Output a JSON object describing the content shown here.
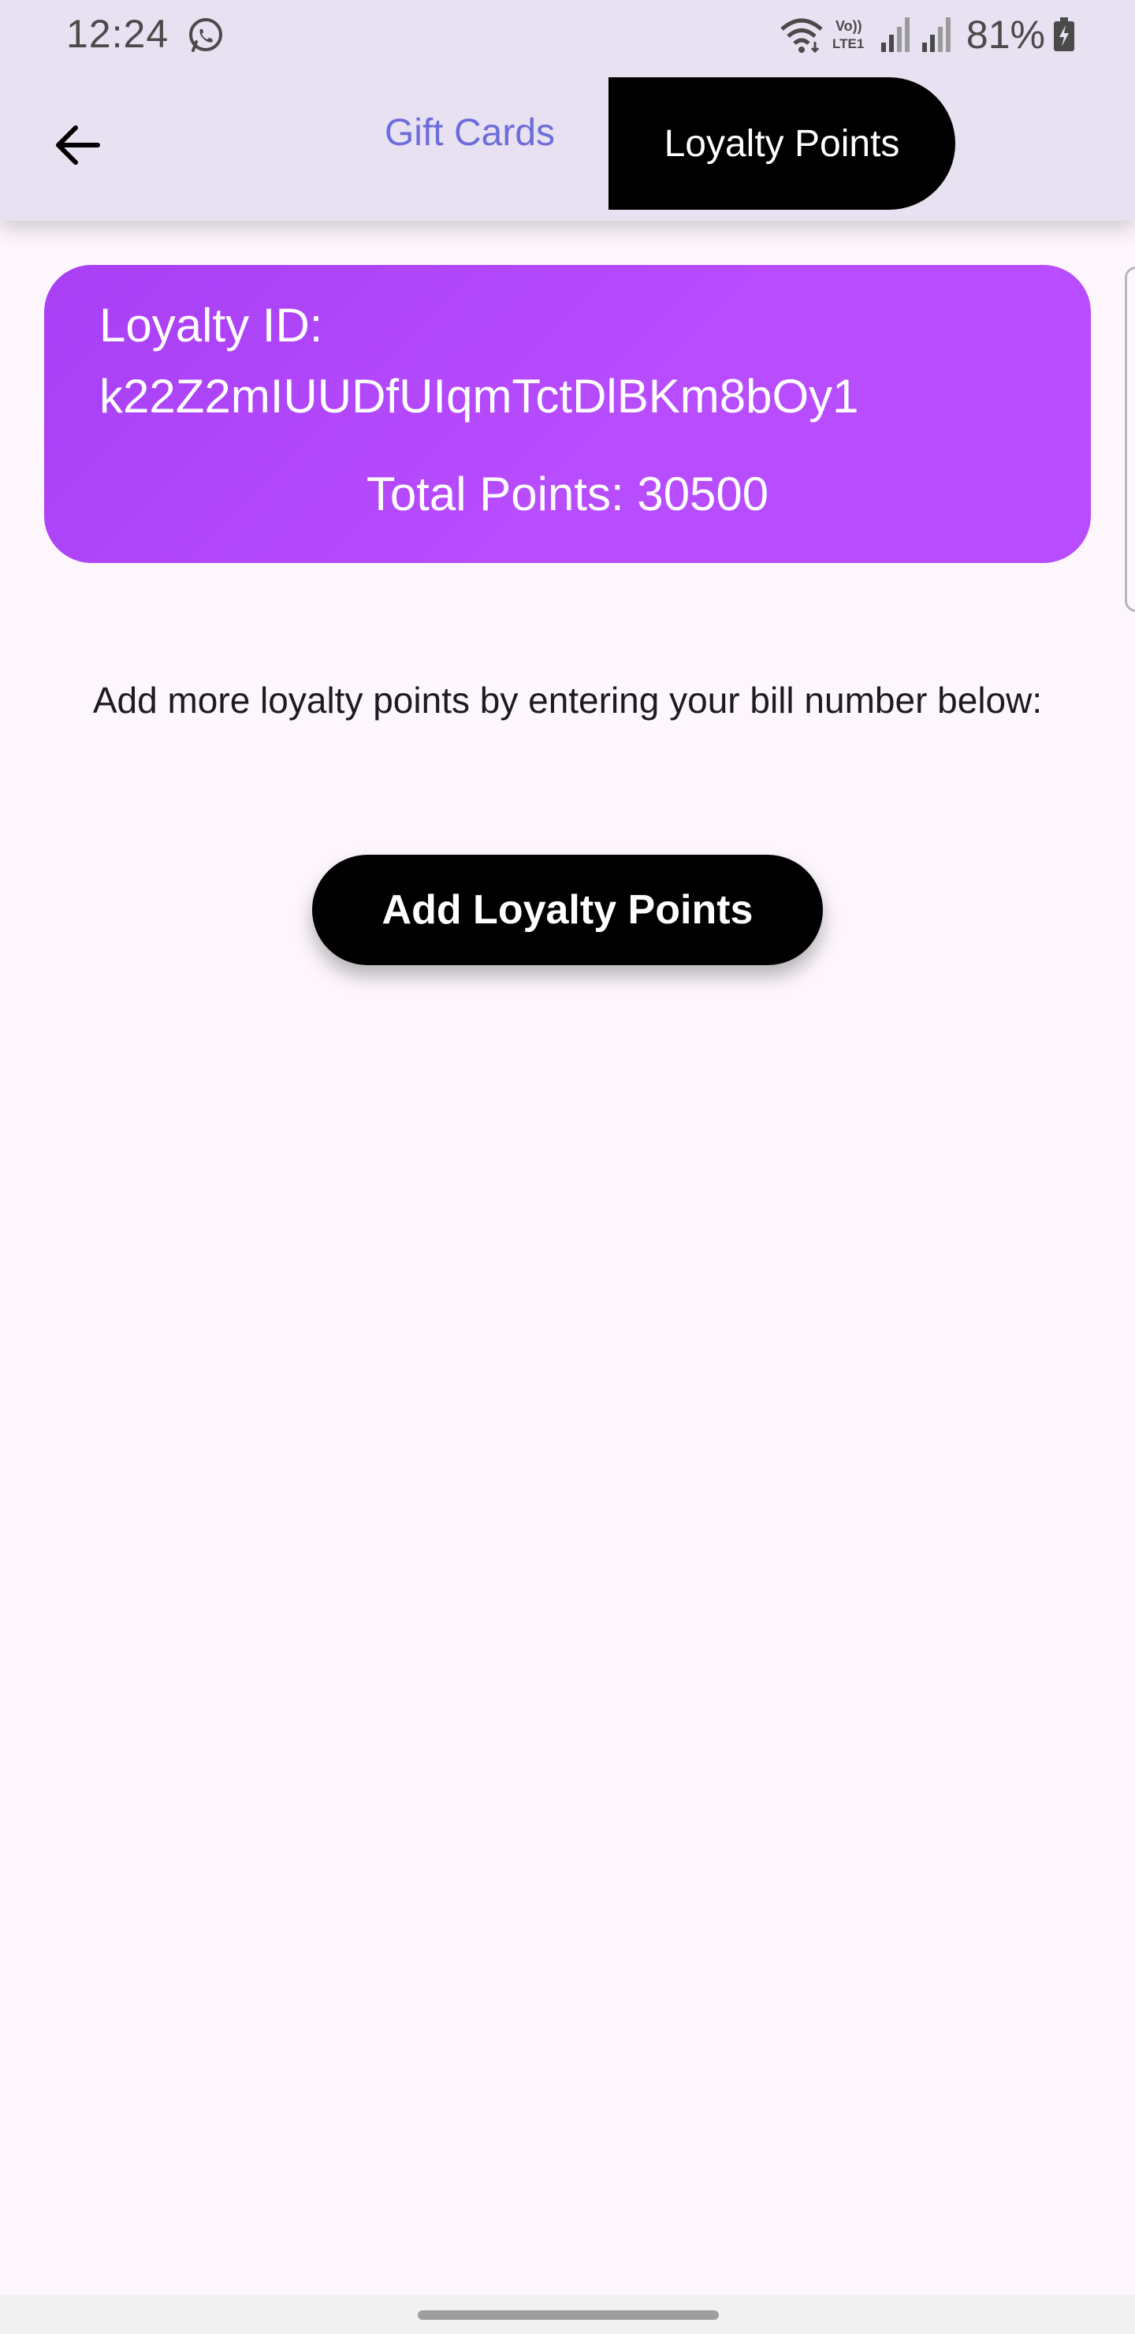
{
  "status_bar": {
    "time": "12:24",
    "battery": "81%",
    "icons": [
      "whatsapp-icon",
      "wifi-icon",
      "volte-lte1-icon",
      "signal-icon",
      "signal-icon",
      "battery-charging-icon"
    ]
  },
  "app_bar": {
    "back_icon": "arrow-left-icon",
    "tabs": [
      {
        "label": "Gift Cards",
        "selected": false
      },
      {
        "label": "Loyalty Points",
        "selected": true
      }
    ]
  },
  "loyalty_card": {
    "id_label": "Loyalty ID:",
    "id_value": "k22Z2mIUUDfUIqmTctDlBKm8bOy1",
    "total_points": "Total Points: 30500"
  },
  "main": {
    "instructions": "Add more loyalty points by entering your bill number below:",
    "add_button_label": "Add Loyalty Points"
  },
  "colors": {
    "app_bar_bg": "#e8e1f2",
    "page_bg": "#fdf7fd",
    "card_purple": "#b84cff",
    "tab_inactive_text": "#6c6cdb",
    "button_black": "#000000"
  }
}
